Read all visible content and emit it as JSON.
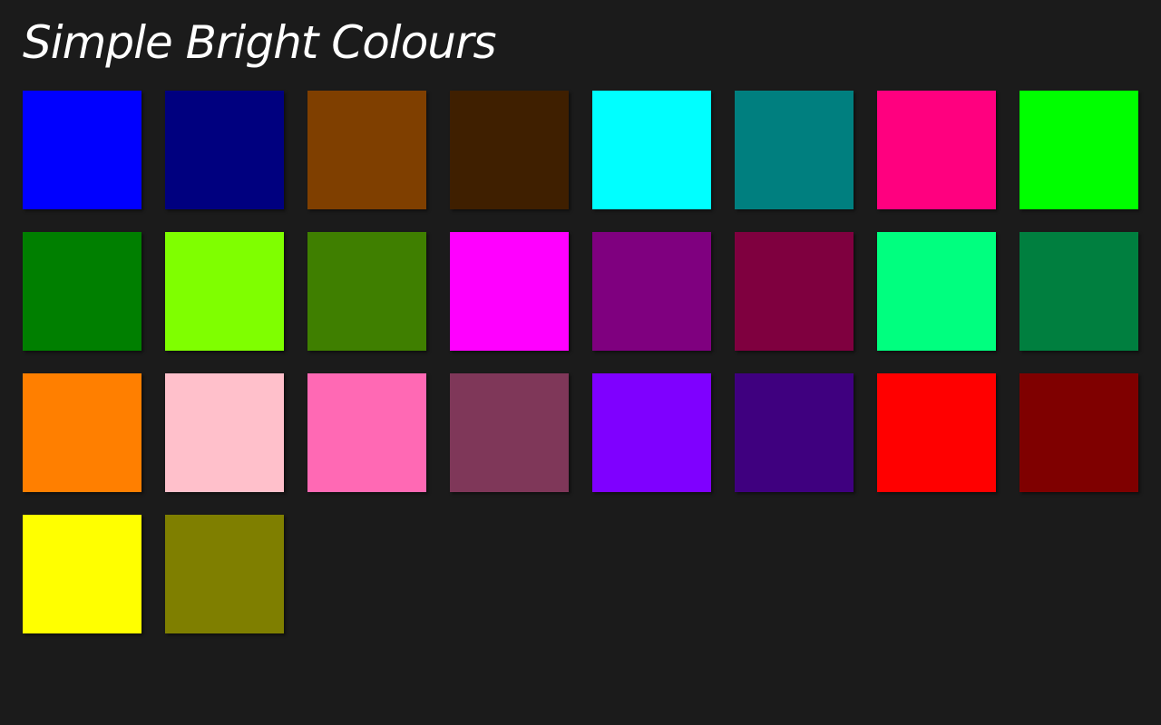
{
  "app": {
    "title": "Simple Bright Colours"
  },
  "swatches": [
    {
      "color": "#0000ff"
    },
    {
      "color": "#00007f"
    },
    {
      "color": "#7f3f00"
    },
    {
      "color": "#3f1f00"
    },
    {
      "color": "#00ffff"
    },
    {
      "color": "#007f7f"
    },
    {
      "color": "#ff007f"
    },
    {
      "color": "#00ff00"
    },
    {
      "color": "#007f00"
    },
    {
      "color": "#7fff00"
    },
    {
      "color": "#3f7f00"
    },
    {
      "color": "#ff00ff"
    },
    {
      "color": "#7f007f"
    },
    {
      "color": "#7f003f"
    },
    {
      "color": "#00ff7f"
    },
    {
      "color": "#007f3f"
    },
    {
      "color": "#ff7f00"
    },
    {
      "color": "#ffc0cb"
    },
    {
      "color": "#ff69b4"
    },
    {
      "color": "#7f3759"
    },
    {
      "color": "#7f00ff"
    },
    {
      "color": "#3f007f"
    },
    {
      "color": "#ff0000"
    },
    {
      "color": "#7f0000"
    },
    {
      "color": "#ffff00"
    },
    {
      "color": "#7f7f00"
    }
  ]
}
